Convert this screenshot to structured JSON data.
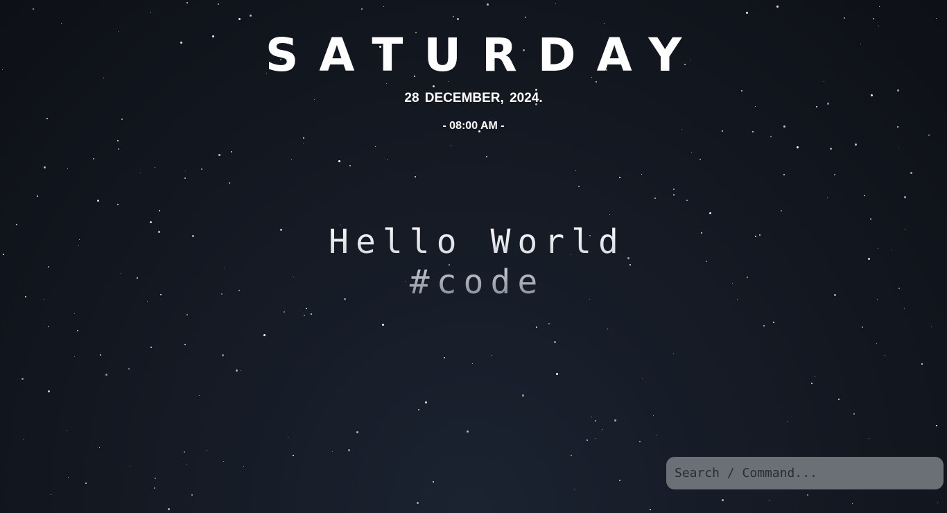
{
  "header": {
    "day": "SATURDAY",
    "date": "28 DECEMBER, 2024.",
    "time": "- 08:00 AM -"
  },
  "greeting": {
    "line1": "Hello World",
    "line2": "#code"
  },
  "search": {
    "placeholder": "Search / Command..."
  },
  "colors": {
    "background": "#151a24",
    "text": "#ffffff",
    "search_bg": "#6b6f76"
  }
}
